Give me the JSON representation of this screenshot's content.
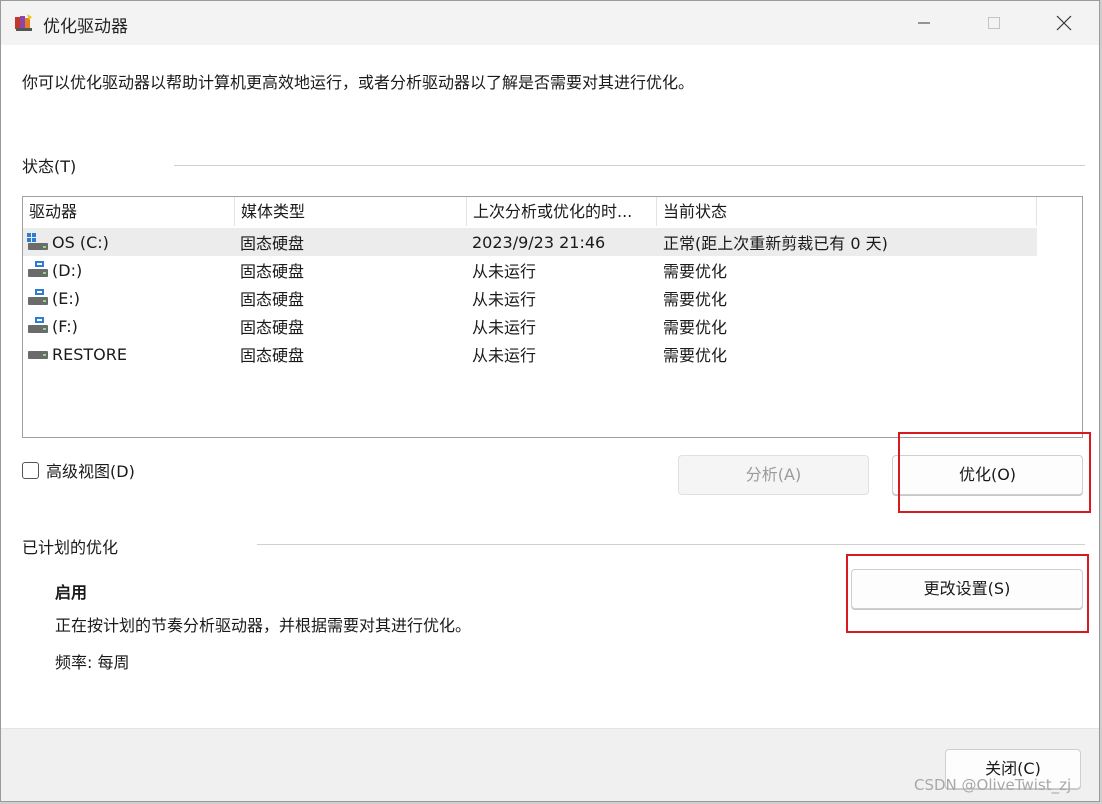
{
  "window": {
    "title": "优化驱动器"
  },
  "intro_text": "你可以优化驱动器以帮助计算机更高效地运行，或者分析驱动器以了解是否需要对其进行优化。",
  "status_section": {
    "label": "状态(T)"
  },
  "table": {
    "headers": [
      "驱动器",
      "媒体类型",
      "上次分析或优化的时...",
      "当前状态"
    ],
    "rows": [
      {
        "drive": "OS (C:)",
        "media": "固态硬盘",
        "last": "2023/9/23 21:46",
        "status": "正常(距上次重新剪裁已有 0 天)",
        "icon": "system-drive-icon"
      },
      {
        "drive": "(D:)",
        "media": "固态硬盘",
        "last": "从未运行",
        "status": "需要优化",
        "icon": "drive-icon"
      },
      {
        "drive": "(E:)",
        "media": "固态硬盘",
        "last": "从未运行",
        "status": "需要优化",
        "icon": "drive-icon"
      },
      {
        "drive": "(F:)",
        "media": "固态硬盘",
        "last": "从未运行",
        "status": "需要优化",
        "icon": "drive-icon"
      },
      {
        "drive": "RESTORE",
        "media": "固态硬盘",
        "last": "从未运行",
        "status": "需要优化",
        "icon": "plain-drive-icon"
      }
    ]
  },
  "advanced_view_label": "高级视图(D)",
  "buttons": {
    "analyze": "分析(A)",
    "optimize": "优化(O)",
    "change_settings": "更改设置(S)",
    "close": "关闭(C)"
  },
  "scheduled": {
    "label": "已计划的优化",
    "title": "启用",
    "description": "正在按计划的节奏分析驱动器，并根据需要对其进行优化。",
    "frequency": "频率: 每周"
  },
  "watermark": "CSDN @OliveTwist_zj",
  "colors": {
    "highlight_box": "#d71921",
    "selected_row": "#ececec"
  }
}
